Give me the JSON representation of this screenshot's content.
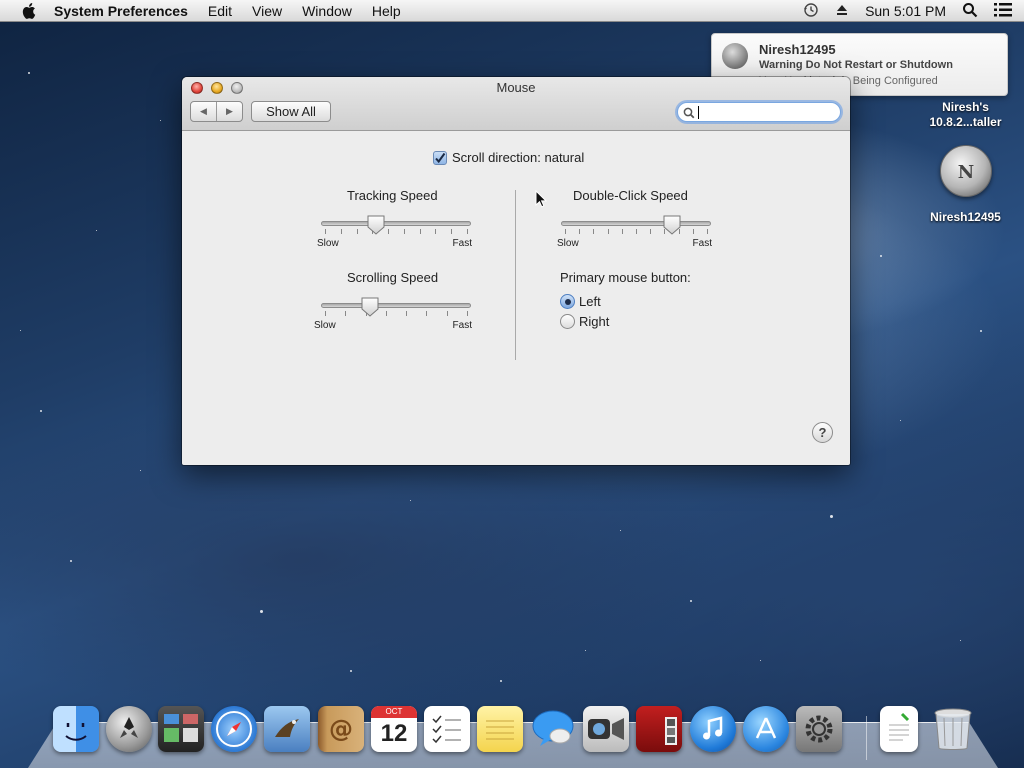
{
  "menubar": {
    "app_name": "System Preferences",
    "items": [
      "Edit",
      "View",
      "Window",
      "Help"
    ],
    "clock": "Sun 5:01 PM"
  },
  "notification": {
    "title": "Niresh12495",
    "subtitle": "Warning Do Not Restart or Shutdown",
    "body": "Your Hackintosh is Being Configured"
  },
  "desktop": {
    "installer_label_line1": "Niresh's",
    "installer_label_line2": "10.8.2...taller",
    "disk_label": "Niresh12495",
    "disk_letter": "N"
  },
  "window": {
    "title": "Mouse",
    "show_all": "Show All",
    "search": {
      "value": "",
      "placeholder": ""
    },
    "scroll_direction": {
      "label": "Scroll direction: natural",
      "checked": true
    },
    "tracking_speed": {
      "label": "Tracking Speed",
      "min_label": "Slow",
      "max_label": "Fast",
      "value": 0.35
    },
    "scrolling_speed": {
      "label": "Scrolling Speed",
      "min_label": "Slow",
      "max_label": "Fast",
      "value": 0.3
    },
    "double_click_speed": {
      "label": "Double-Click Speed",
      "min_label": "Slow",
      "max_label": "Fast",
      "value": 0.77
    },
    "primary_button": {
      "label": "Primary mouse button:",
      "options": [
        "Left",
        "Right"
      ],
      "selected": "Left"
    },
    "help": "?"
  },
  "dock": {
    "items": [
      "Finder",
      "Launchpad",
      "Mission Control",
      "Safari",
      "Mail",
      "Contacts",
      "Calendar",
      "Reminders",
      "Notes",
      "Messages",
      "FaceTime",
      "Photo Booth",
      "iTunes",
      "App Store",
      "System Preferences",
      "Document",
      "Trash"
    ],
    "calendar_day": "12",
    "calendar_month": "OCT"
  }
}
